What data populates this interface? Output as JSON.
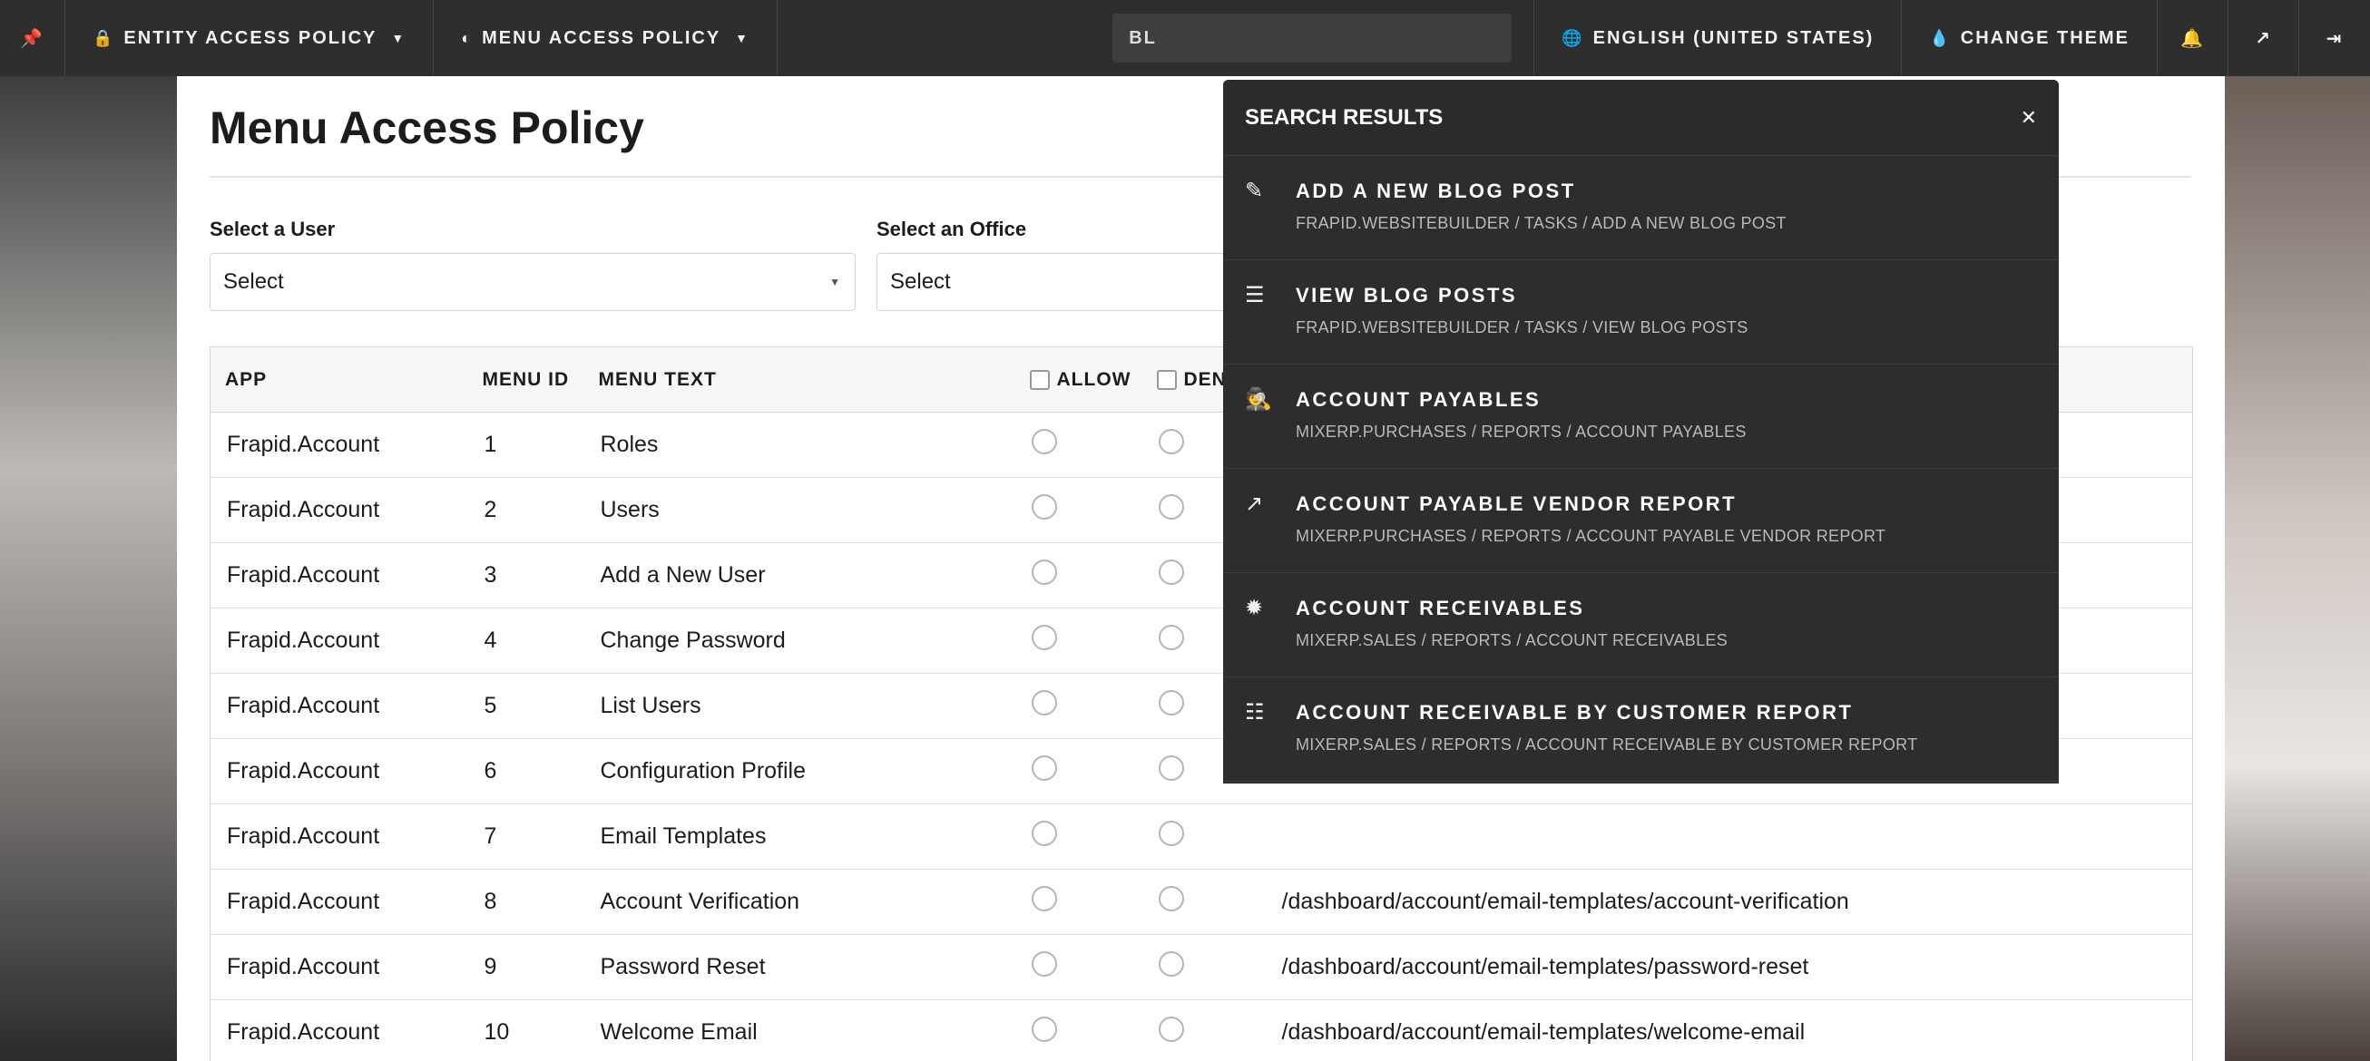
{
  "topbar": {
    "entity_access": "ENTITY ACCESS POLICY",
    "menu_access": "MENU ACCESS POLICY",
    "search_value": "BL",
    "language": "ENGLISH (UNITED STATES)",
    "change_theme": "CHANGE THEME"
  },
  "page": {
    "title": "Menu Access Policy",
    "user_label": "Select a User",
    "user_value": "Select",
    "office_label": "Select an Office",
    "office_value": "Select"
  },
  "table": {
    "headers": {
      "app": "APP",
      "menu_id": "MENU ID",
      "menu_text": "MENU TEXT",
      "allow": "ALLOW",
      "deny": "DEN"
    },
    "rows": [
      {
        "app": "Frapid.Account",
        "id": "1",
        "text": "Roles",
        "url": ""
      },
      {
        "app": "Frapid.Account",
        "id": "2",
        "text": "Users",
        "url": ""
      },
      {
        "app": "Frapid.Account",
        "id": "3",
        "text": "Add a New User",
        "url": ""
      },
      {
        "app": "Frapid.Account",
        "id": "4",
        "text": "Change Password",
        "url": ""
      },
      {
        "app": "Frapid.Account",
        "id": "5",
        "text": "List Users",
        "url": ""
      },
      {
        "app": "Frapid.Account",
        "id": "6",
        "text": "Configuration Profile",
        "url": ""
      },
      {
        "app": "Frapid.Account",
        "id": "7",
        "text": "Email Templates",
        "url": ""
      },
      {
        "app": "Frapid.Account",
        "id": "8",
        "text": "Account Verification",
        "url": "/dashboard/account/email-templates/account-verification"
      },
      {
        "app": "Frapid.Account",
        "id": "9",
        "text": "Password Reset",
        "url": "/dashboard/account/email-templates/password-reset"
      },
      {
        "app": "Frapid.Account",
        "id": "10",
        "text": "Welcome Email",
        "url": "/dashboard/account/email-templates/welcome-email"
      }
    ]
  },
  "search_results": {
    "title": "SEARCH RESULTS",
    "items": [
      {
        "icon": "pencil-icon",
        "title": "ADD A NEW BLOG POST",
        "path": "FRAPID.WEBSITEBUILDER / TASKS / ADD A NEW BLOG POST"
      },
      {
        "icon": "list-alt-icon",
        "title": "VIEW BLOG POSTS",
        "path": "FRAPID.WEBSITEBUILDER / TASKS / VIEW BLOG POSTS"
      },
      {
        "icon": "spy-icon",
        "title": "ACCOUNT PAYABLES",
        "path": "MIXERP.PURCHASES / REPORTS / ACCOUNT PAYABLES"
      },
      {
        "icon": "share-icon",
        "title": "ACCOUNT PAYABLE VENDOR REPORT",
        "path": "MIXERP.PURCHASES / REPORTS / ACCOUNT PAYABLE VENDOR REPORT"
      },
      {
        "icon": "certificate-icon",
        "title": "ACCOUNT RECEIVABLES",
        "path": "MIXERP.SALES / REPORTS / ACCOUNT RECEIVABLES"
      },
      {
        "icon": "list-icon",
        "title": "ACCOUNT RECEIVABLE BY CUSTOMER REPORT",
        "path": "MIXERP.SALES / REPORTS / ACCOUNT RECEIVABLE BY CUSTOMER REPORT"
      }
    ]
  }
}
